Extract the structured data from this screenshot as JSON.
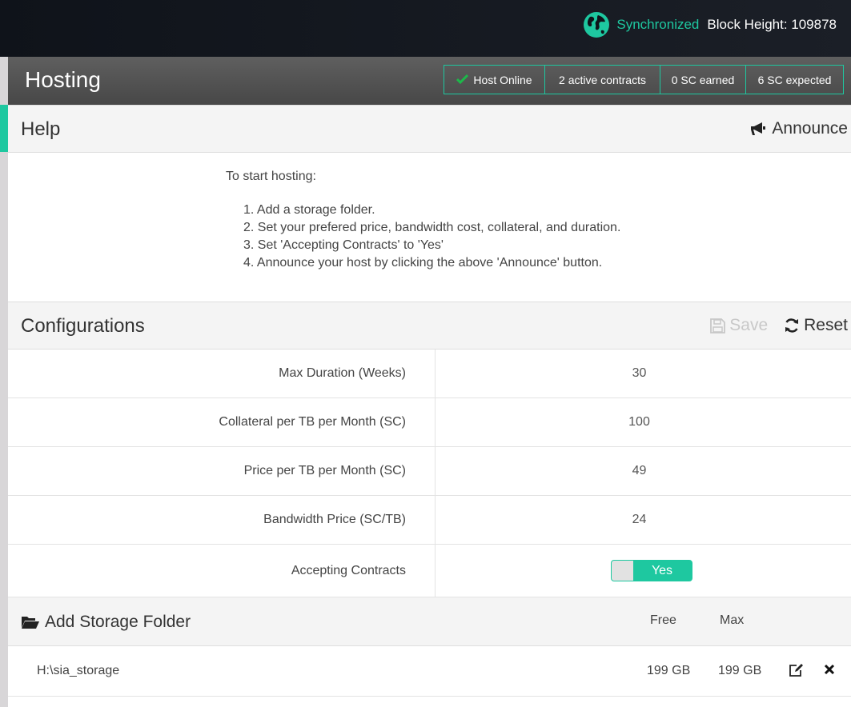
{
  "topbar": {
    "sync_status": "Synchronized",
    "block_height": "Block Height: 109878",
    "globe_icon": "globe-icon",
    "accent": "#1ec8a0"
  },
  "hosting": {
    "title": "Hosting",
    "stats": [
      "Host Online",
      "2 active contracts",
      "0 SC earned",
      "6 SC expected"
    ]
  },
  "help": {
    "title": "Help",
    "announce_label": "Announce",
    "intro": "To start hosting:",
    "steps": [
      "1. Add a storage folder.",
      "2. Set your prefered price, bandwidth cost, collateral, and duration.",
      "3. Set 'Accepting Contracts' to 'Yes'",
      "4. Announce your host by clicking the above 'Announce' button."
    ]
  },
  "config": {
    "title": "Configurations",
    "save_label": "Save",
    "reset_label": "Reset",
    "rows": [
      {
        "label": "Max Duration (Weeks)",
        "value": "30"
      },
      {
        "label": "Collateral per TB per Month (SC)",
        "value": "100"
      },
      {
        "label": "Price per TB per Month (SC)",
        "value": "49"
      },
      {
        "label": "Bandwidth Price (SC/TB)",
        "value": "24"
      }
    ],
    "accepting": {
      "label": "Accepting Contracts",
      "value": "Yes"
    }
  },
  "storage": {
    "add_label": "Add Storage Folder",
    "col_free": "Free",
    "col_max": "Max",
    "folders": [
      {
        "path": "H:\\sia_storage",
        "free": "199 GB",
        "max": "199 GB"
      }
    ]
  }
}
